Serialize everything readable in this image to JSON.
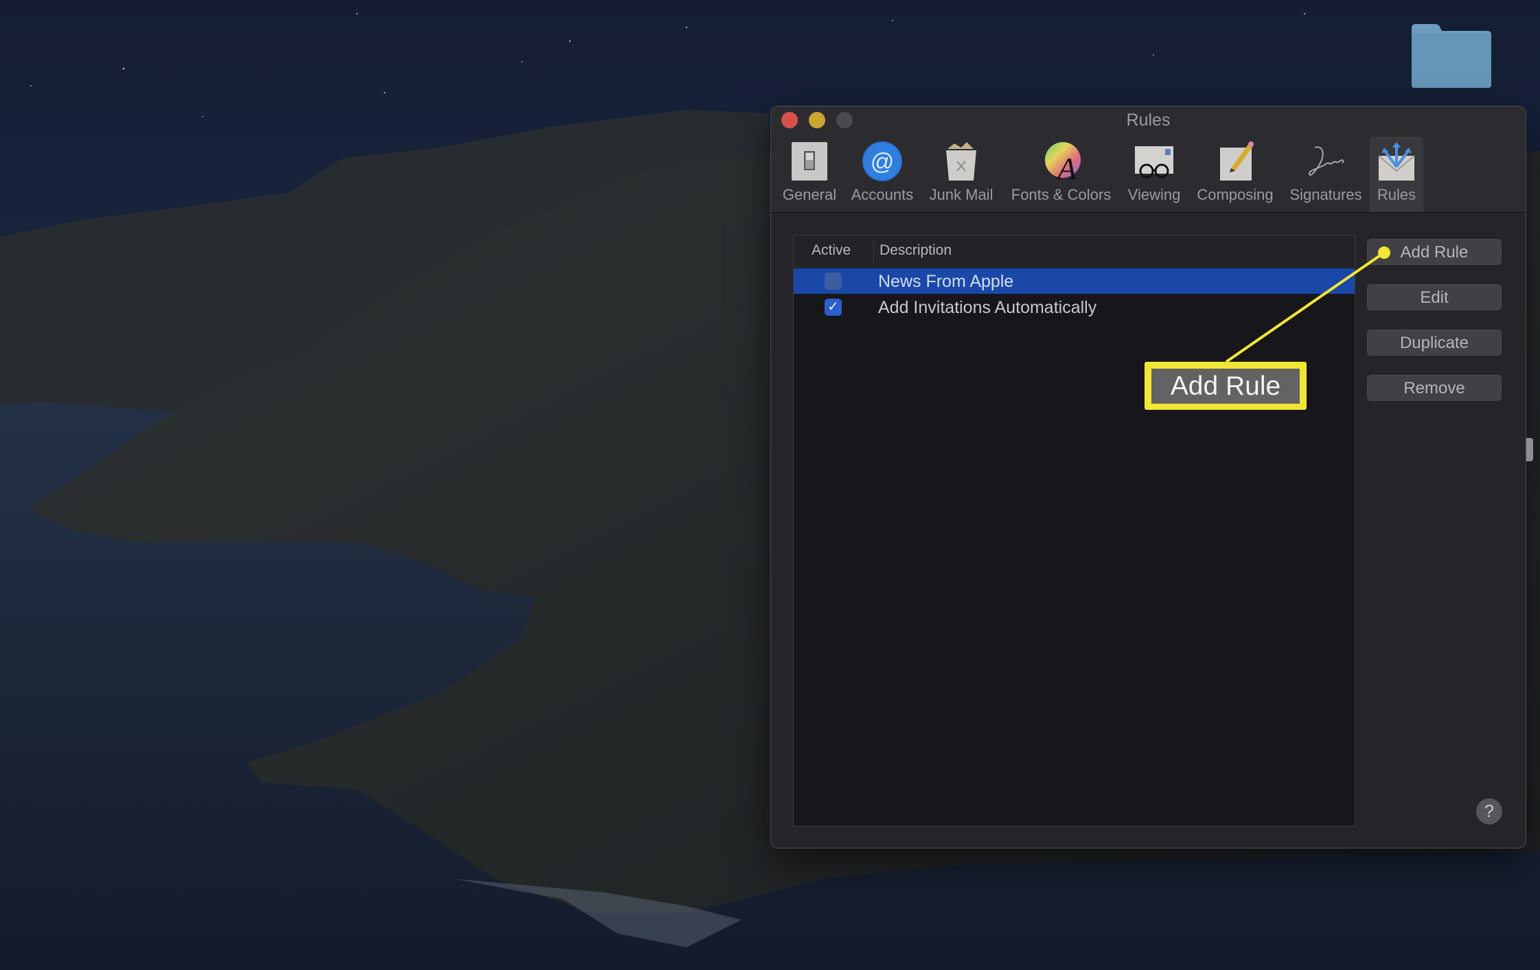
{
  "window": {
    "title": "Rules",
    "traffic_lights": [
      "close",
      "minimize",
      "zoom"
    ]
  },
  "toolbar": {
    "items": [
      {
        "label": "General",
        "icon": "switch-icon",
        "selected": false
      },
      {
        "label": "Accounts",
        "icon": "at-sign-icon",
        "selected": false
      },
      {
        "label": "Junk Mail",
        "icon": "trash-can-icon",
        "selected": false
      },
      {
        "label": "Fonts & Colors",
        "icon": "color-wheel-font-icon",
        "selected": false
      },
      {
        "label": "Viewing",
        "icon": "glasses-envelope-icon",
        "selected": false
      },
      {
        "label": "Composing",
        "icon": "pencil-paper-icon",
        "selected": false
      },
      {
        "label": "Signatures",
        "icon": "signature-icon",
        "selected": false
      },
      {
        "label": "Rules",
        "icon": "rules-envelope-icon",
        "selected": true
      }
    ]
  },
  "rules_table": {
    "columns": [
      "Active",
      "Description"
    ],
    "rows": [
      {
        "active": false,
        "description": "News From Apple",
        "selected": true
      },
      {
        "active": true,
        "description": "Add Invitations Automatically",
        "selected": false
      }
    ],
    "check_glyph": "✓"
  },
  "buttons": {
    "add_rule": "Add Rule",
    "edit": "Edit",
    "duplicate": "Duplicate",
    "remove": "Remove",
    "help": "?"
  },
  "annotation": {
    "callout_text": "Add Rule",
    "color": "#f1e635"
  },
  "colors": {
    "selection": "#1a48a8",
    "window_bg": "#252428",
    "close": "#d6514a",
    "minimize": "#c9a532"
  }
}
